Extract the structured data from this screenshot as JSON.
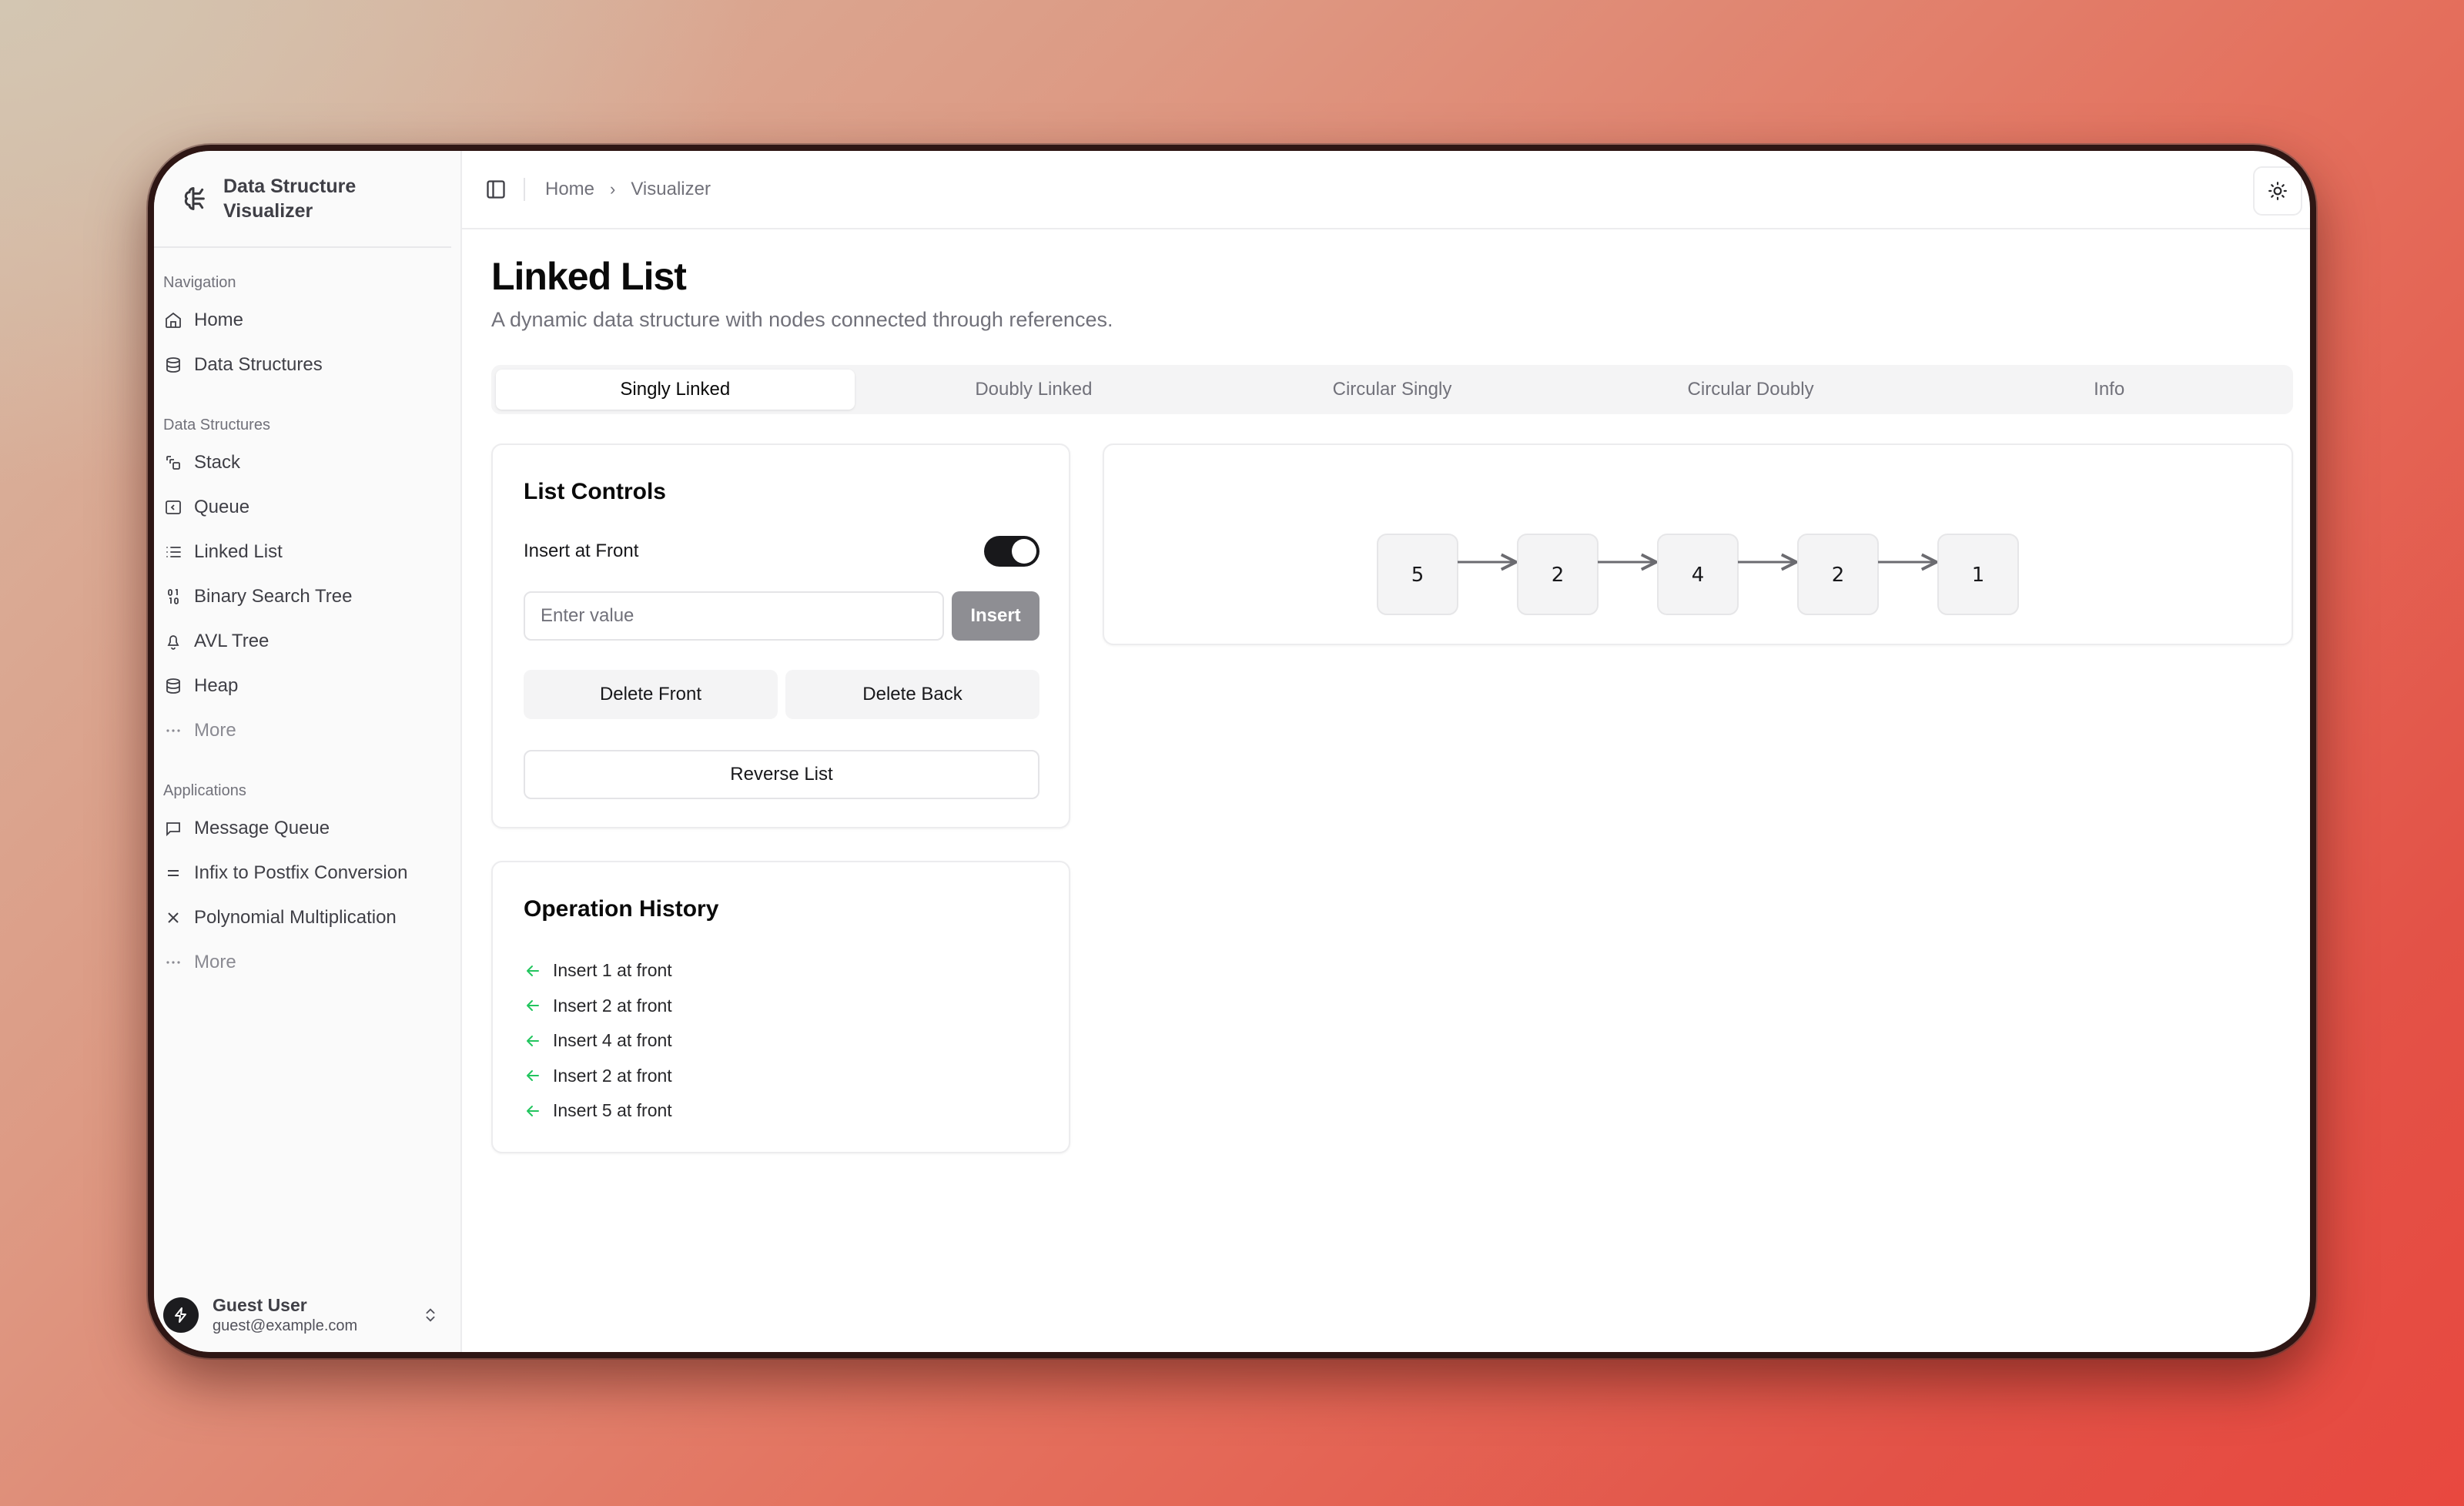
{
  "app": {
    "brand_line1": "Data Structure",
    "brand_line2": "Visualizer"
  },
  "sidebar": {
    "groups": [
      {
        "label": "Navigation",
        "items": [
          {
            "label": "Home",
            "icon": "home-icon"
          },
          {
            "label": "Data Structures",
            "icon": "database-icon"
          }
        ]
      },
      {
        "label": "Data Structures",
        "items": [
          {
            "label": "Stack",
            "icon": "stack-icon"
          },
          {
            "label": "Queue",
            "icon": "queue-icon"
          },
          {
            "label": "Linked List",
            "icon": "list-icon"
          },
          {
            "label": "Binary Search Tree",
            "icon": "binary-icon"
          },
          {
            "label": "AVL Tree",
            "icon": "bell-icon"
          },
          {
            "label": "Heap",
            "icon": "database-icon"
          },
          {
            "label": "More",
            "icon": "more-icon"
          }
        ]
      },
      {
        "label": "Applications",
        "items": [
          {
            "label": "Message Queue",
            "icon": "message-icon"
          },
          {
            "label": "Infix to Postfix Conversion",
            "icon": "equals-icon"
          },
          {
            "label": "Polynomial Multiplication",
            "icon": "multiply-icon"
          },
          {
            "label": "More",
            "icon": "more-icon"
          }
        ]
      }
    ],
    "user": {
      "name": "Guest User",
      "email": "guest@example.com"
    }
  },
  "header": {
    "breadcrumb": [
      "Home",
      "Visualizer"
    ]
  },
  "page": {
    "title": "Linked List",
    "subtitle": "A dynamic data structure with nodes connected through references."
  },
  "tabs": [
    {
      "label": "Singly Linked",
      "active": true
    },
    {
      "label": "Doubly Linked",
      "active": false
    },
    {
      "label": "Circular Singly",
      "active": false
    },
    {
      "label": "Circular Doubly",
      "active": false
    },
    {
      "label": "Info",
      "active": false
    }
  ],
  "controls": {
    "title": "List Controls",
    "toggle_label": "Insert at Front",
    "toggle_on": true,
    "input_value": "",
    "input_placeholder": "Enter value",
    "insert_label": "Insert",
    "delete_front_label": "Delete Front",
    "delete_back_label": "Delete Back",
    "reverse_label": "Reverse List"
  },
  "history": {
    "title": "Operation History",
    "items": [
      "Insert 1 at front",
      "Insert 2 at front",
      "Insert 4 at front",
      "Insert 2 at front",
      "Insert 5 at front"
    ],
    "accent_color": "#22c55e"
  },
  "list_nodes": [
    5,
    2,
    4,
    2,
    1
  ]
}
